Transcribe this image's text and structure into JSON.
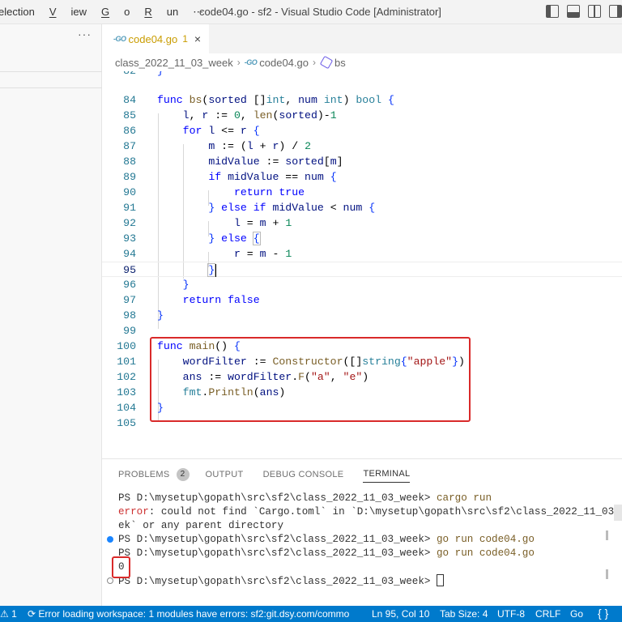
{
  "menu": {
    "items": [
      "election",
      "View",
      "Go",
      "Run",
      "⋯"
    ]
  },
  "window_title": "code04.go - sf2 - Visual Studio Code [Administrator]",
  "sidebar": {
    "more": "···"
  },
  "tab": {
    "icon": "go-file-icon",
    "label": "code04.go",
    "problems": "1",
    "close": "×"
  },
  "breadcrumb": [
    "class_2022_11_03_week",
    "code04.go",
    "bs"
  ],
  "editor": {
    "line_numbers": [
      "82",
      "84",
      "85",
      "86",
      "87",
      "88",
      "89",
      "90",
      "91",
      "92",
      "93",
      "94",
      "95",
      "96",
      "97",
      "98",
      "99",
      "100",
      "101",
      "102",
      "103",
      "104",
      "105"
    ]
  },
  "panel": {
    "tabs": [
      "PROBLEMS",
      "OUTPUT",
      "DEBUG CONSOLE",
      "TERMINAL"
    ],
    "problem_count": "2",
    "terminal_lines": [
      {
        "prompt": "PS D:\\mysetup\\gopath\\src\\sf2\\class_2022_11_03_week> ",
        "cmd": "cargo run"
      },
      {
        "err": "error",
        "text": ": could not find `Cargo.toml` in `D:\\mysetup\\gopath\\src\\sf2\\class_2022_11_03_we"
      },
      {
        "text": "ek` or any parent directory"
      },
      {
        "prompt": "PS D:\\mysetup\\gopath\\src\\sf2\\class_2022_11_03_week> ",
        "cmd": "go run code04.go"
      },
      {
        "prompt": "PS D:\\mysetup\\gopath\\src\\sf2\\class_2022_11_03_week> ",
        "cmd": "go run code04.go"
      },
      {
        "text": "0"
      },
      {
        "prompt": "PS D:\\mysetup\\gopath\\src\\sf2\\class_2022_11_03_week> "
      }
    ]
  },
  "statusbar": {
    "problems": "⚠ 1",
    "error_msg": "Error loading workspace: 1 modules have errors: sf2:git.dsy.com/commo",
    "position": "Ln 95, Col 10",
    "tab_size": "Tab Size: 4",
    "encoding": "UTF-8",
    "eol": "CRLF",
    "language": "Go"
  }
}
